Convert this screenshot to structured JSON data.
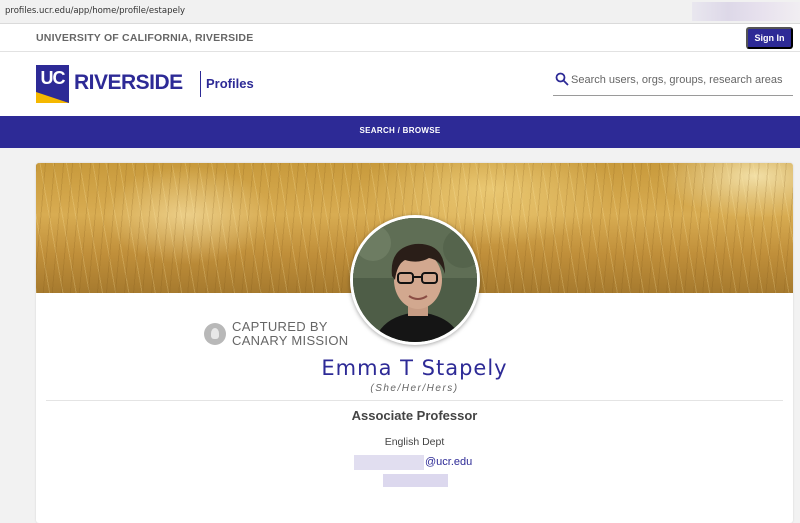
{
  "browser": {
    "url": "profiles.ucr.edu/app/home/profile/estapely"
  },
  "topbar": {
    "university": "UNIVERSITY OF CALIFORNIA, RIVERSIDE",
    "signin_label": "Sign In"
  },
  "header": {
    "logo_uc": "UC",
    "logo_name": "RIVERSIDE",
    "logo_product": "Profiles",
    "search_placeholder": "Search users, orgs, groups, research areas"
  },
  "nav": {
    "label": "SEARCH / BROWSE"
  },
  "profile": {
    "watermark_line1": "CAPTURED BY",
    "watermark_line2": "CANARY MISSION",
    "name": "Emma T Stapely",
    "pronouns": "(She/Her/Hers)",
    "title": "Associate Professor",
    "department": "English Dept",
    "email_domain": "@ucr.edu"
  },
  "colors": {
    "brand": "#2d2a96",
    "gold": "#f5b800"
  }
}
